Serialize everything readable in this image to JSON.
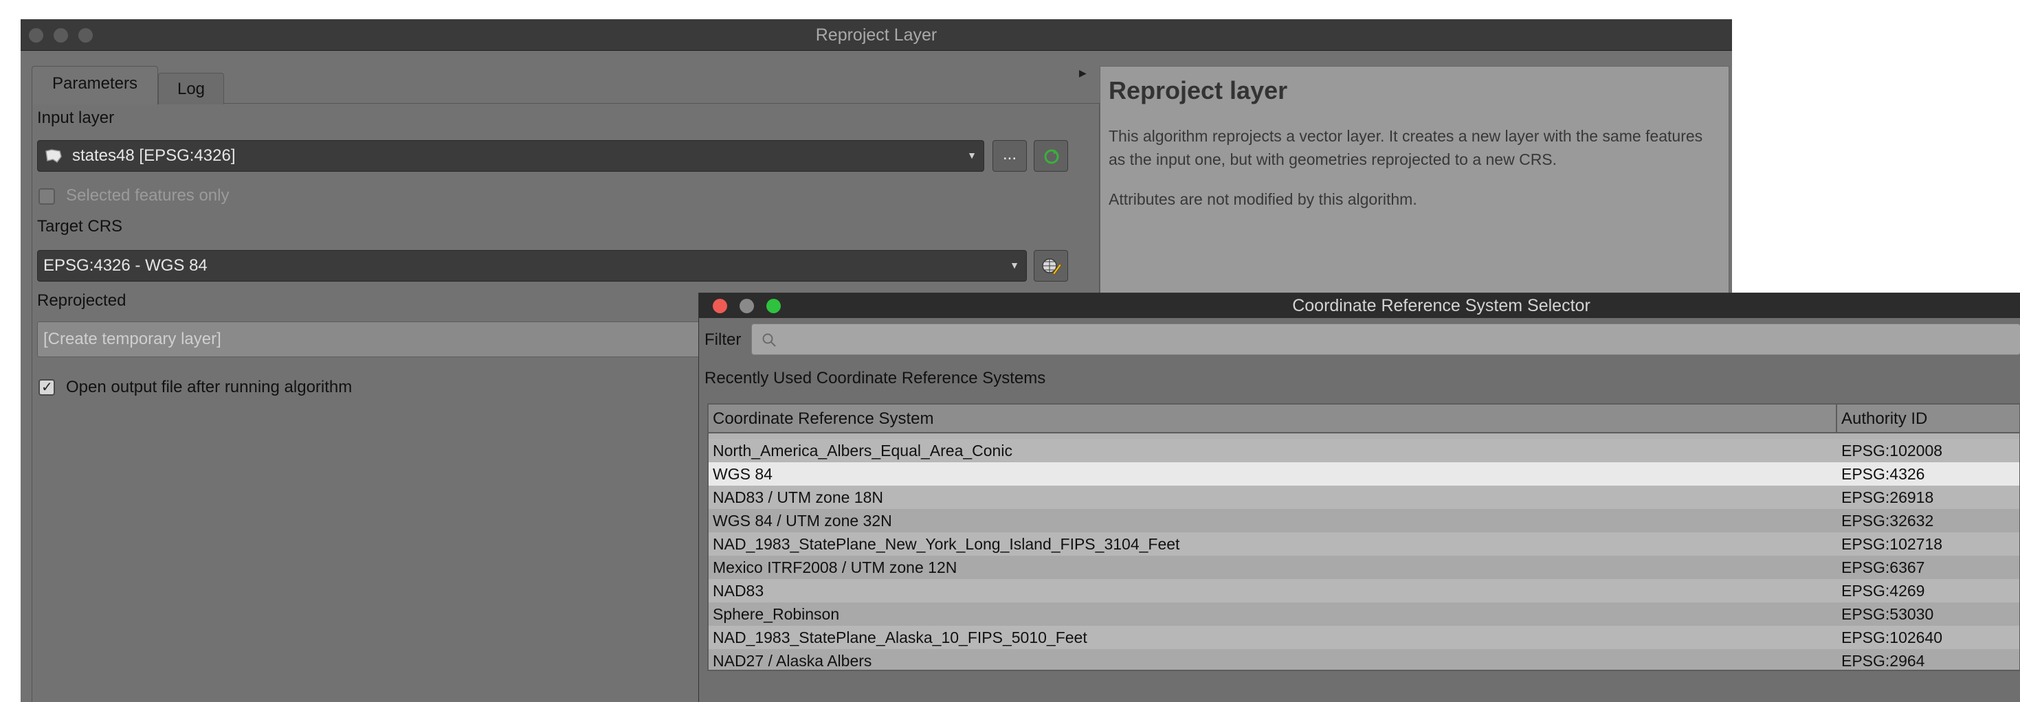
{
  "reproject_window": {
    "title": "Reproject Layer",
    "tabs": [
      {
        "label": "Parameters"
      },
      {
        "label": "Log"
      }
    ],
    "input_layer": {
      "label": "Input layer",
      "value": "states48 [EPSG:4326]",
      "browse_label": "..."
    },
    "selected_only": {
      "label": "Selected features only",
      "checked": false
    },
    "target_crs": {
      "label": "Target CRS",
      "value": "EPSG:4326 - WGS 84"
    },
    "output": {
      "label": "Reprojected",
      "placeholder": "[Create temporary layer]"
    },
    "open_output": {
      "label": "Open output file after running algorithm",
      "checked": true
    },
    "help": {
      "title": "Reproject layer",
      "paragraph1": "This algorithm reprojects a vector layer. It creates a new layer with the same features as the input one, but with geometries reprojected to a new CRS.",
      "paragraph2": "Attributes are not modified by this algorithm."
    }
  },
  "crs_dialog": {
    "title": "Coordinate Reference System Selector",
    "filter_label": "Filter",
    "filter_value": "",
    "recent_heading": "Recently Used Coordinate Reference Systems",
    "columns": {
      "crs": "Coordinate Reference System",
      "authority": "Authority ID"
    },
    "selected_index": 1,
    "rows": [
      {
        "name": "North_America_Albers_Equal_Area_Conic",
        "authority": "EPSG:102008"
      },
      {
        "name": "WGS 84",
        "authority": "EPSG:4326"
      },
      {
        "name": "NAD83 / UTM zone 18N",
        "authority": "EPSG:26918"
      },
      {
        "name": "WGS 84 / UTM zone 32N",
        "authority": "EPSG:32632"
      },
      {
        "name": "NAD_1983_StatePlane_New_York_Long_Island_FIPS_3104_Feet",
        "authority": "EPSG:102718"
      },
      {
        "name": "Mexico ITRF2008 / UTM zone 12N",
        "authority": "EPSG:6367"
      },
      {
        "name": "NAD83",
        "authority": "EPSG:4269"
      },
      {
        "name": "Sphere_Robinson",
        "authority": "EPSG:53030"
      },
      {
        "name": "NAD_1983_StatePlane_Alaska_10_FIPS_5010_Feet",
        "authority": "EPSG:102640"
      },
      {
        "name": "NAD27 / Alaska Albers",
        "authority": "EPSG:2964"
      }
    ]
  },
  "colors": {
    "close": "#ee5b54",
    "minimize": "#8a8a8a",
    "zoom": "#2fc23f",
    "selection": "#e9e9e9"
  }
}
